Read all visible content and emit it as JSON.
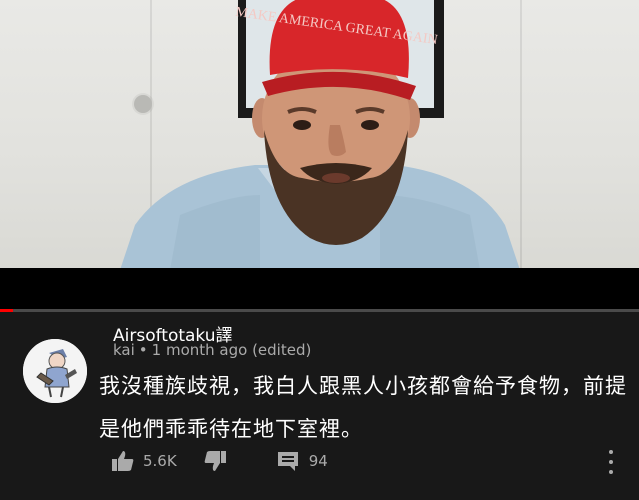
{
  "video": {
    "cap_text": "MAKE AMERICA GREAT AGAIN",
    "progress_fraction": 0.02,
    "colors": {
      "cap": "#d8262a",
      "progress": "#ff0000"
    }
  },
  "comment": {
    "author": "Airsoftotaku譯",
    "sub_author": "kai",
    "dot": "•",
    "time": "1 month ago (edited)",
    "text": "我沒種族歧視，我白人跟黑人小孩都會給予食物，前提是他們乖乖待在地下室裡。",
    "like_count": "5.6K",
    "reply_count": "94",
    "icons": {
      "like": "thumbs-up-icon",
      "dislike": "thumbs-down-icon",
      "reply": "reply-icon",
      "more": "more-vert-icon"
    }
  }
}
